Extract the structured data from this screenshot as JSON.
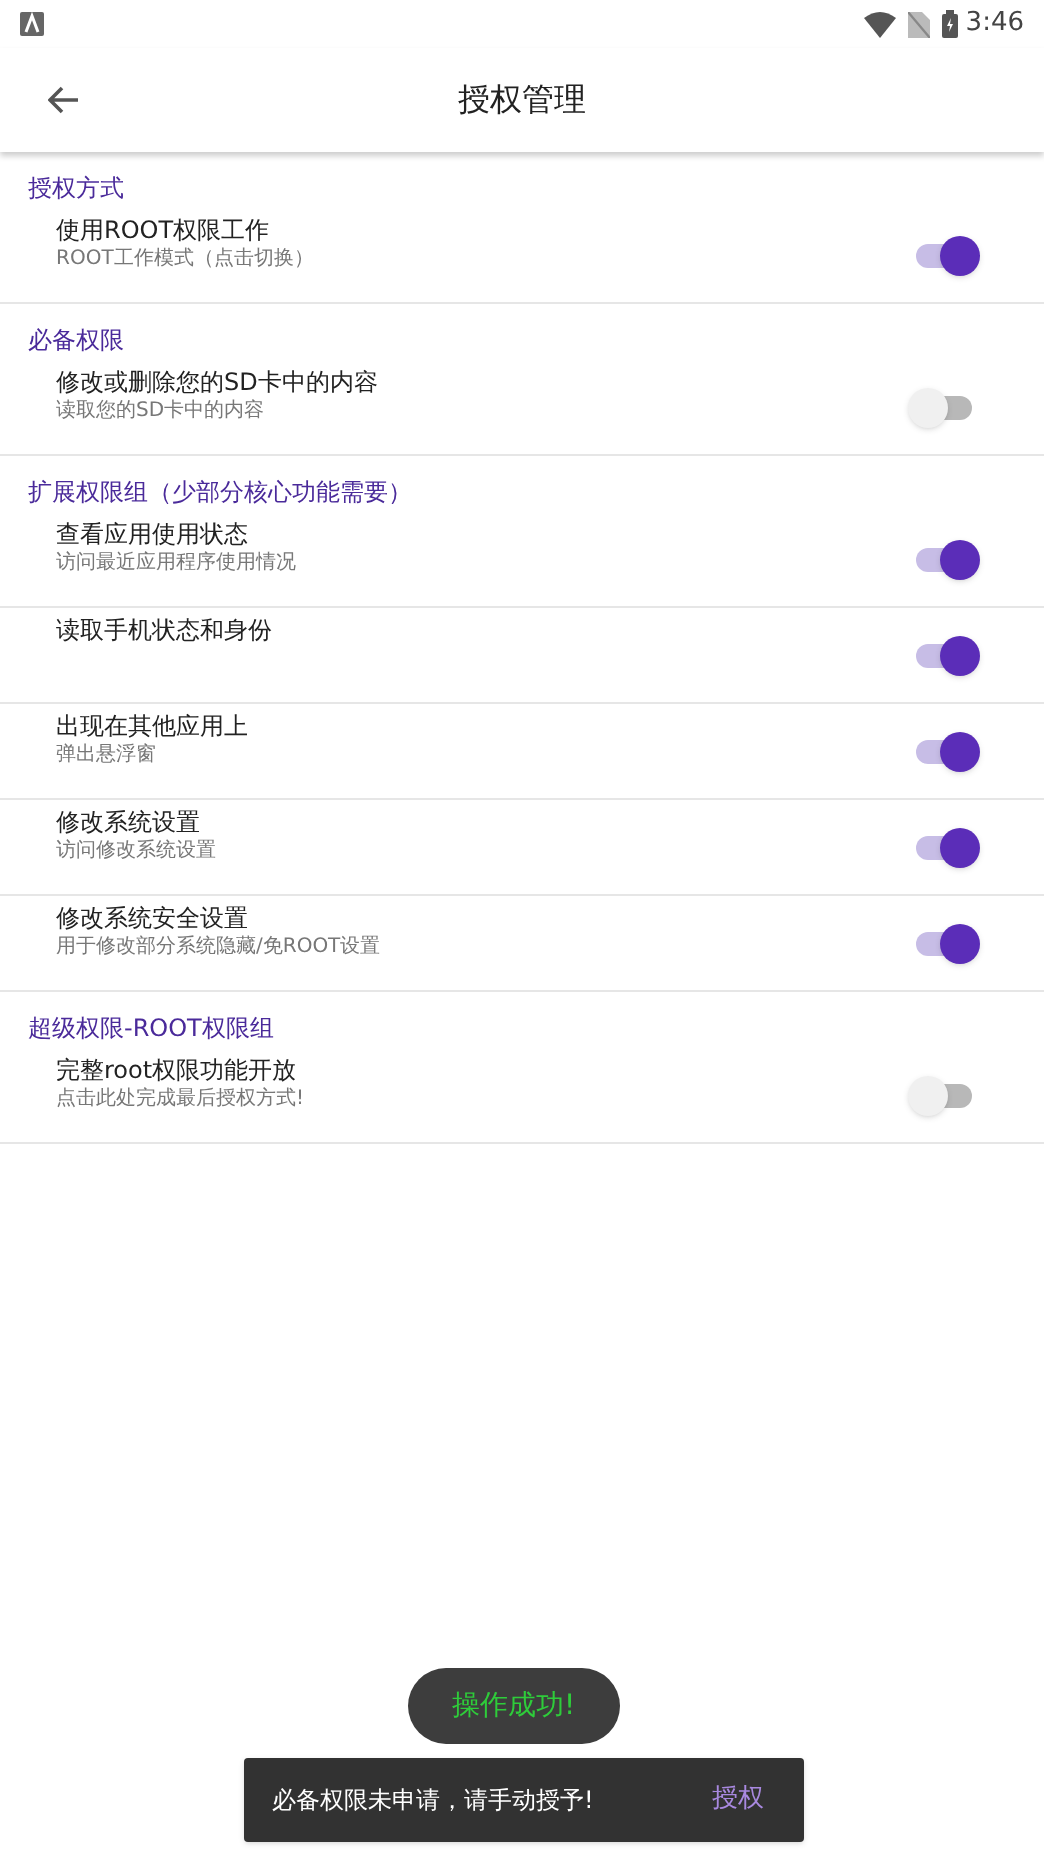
{
  "status_bar": {
    "time": "3:46"
  },
  "toolbar": {
    "title": "授权管理"
  },
  "sections": [
    {
      "title": "授权方式",
      "items": [
        {
          "title": "使用ROOT权限工作",
          "subtitle": "ROOT工作模式（点击切换）",
          "checked": true
        }
      ]
    },
    {
      "title": "必备权限",
      "items": [
        {
          "title": "修改或删除您的SD卡中的内容",
          "subtitle": "读取您的SD卡中的内容",
          "checked": false
        }
      ]
    },
    {
      "title": "扩展权限组（少部分核心功能需要）",
      "items": [
        {
          "title": "查看应用使用状态",
          "subtitle": "访问最近应用程序使用情况",
          "checked": true
        },
        {
          "title": "读取手机状态和身份",
          "checked": true
        },
        {
          "title": "出现在其他应用上",
          "subtitle": "弹出悬浮窗",
          "checked": true
        },
        {
          "title": "修改系统设置",
          "subtitle": "访问修改系统设置",
          "checked": true
        },
        {
          "title": "修改系统安全设置",
          "subtitle": "用于修改部分系统隐藏/免ROOT设置",
          "checked": true
        }
      ]
    },
    {
      "title": "超级权限-ROOT权限组",
      "items": [
        {
          "title": "完整root权限功能开放",
          "subtitle": "点击此处完成最后授权方式!",
          "checked": false
        }
      ]
    }
  ],
  "toast": "操作成功!",
  "snackbar": {
    "message": "必备权限未申请，请手动授予!",
    "action": "授权"
  }
}
